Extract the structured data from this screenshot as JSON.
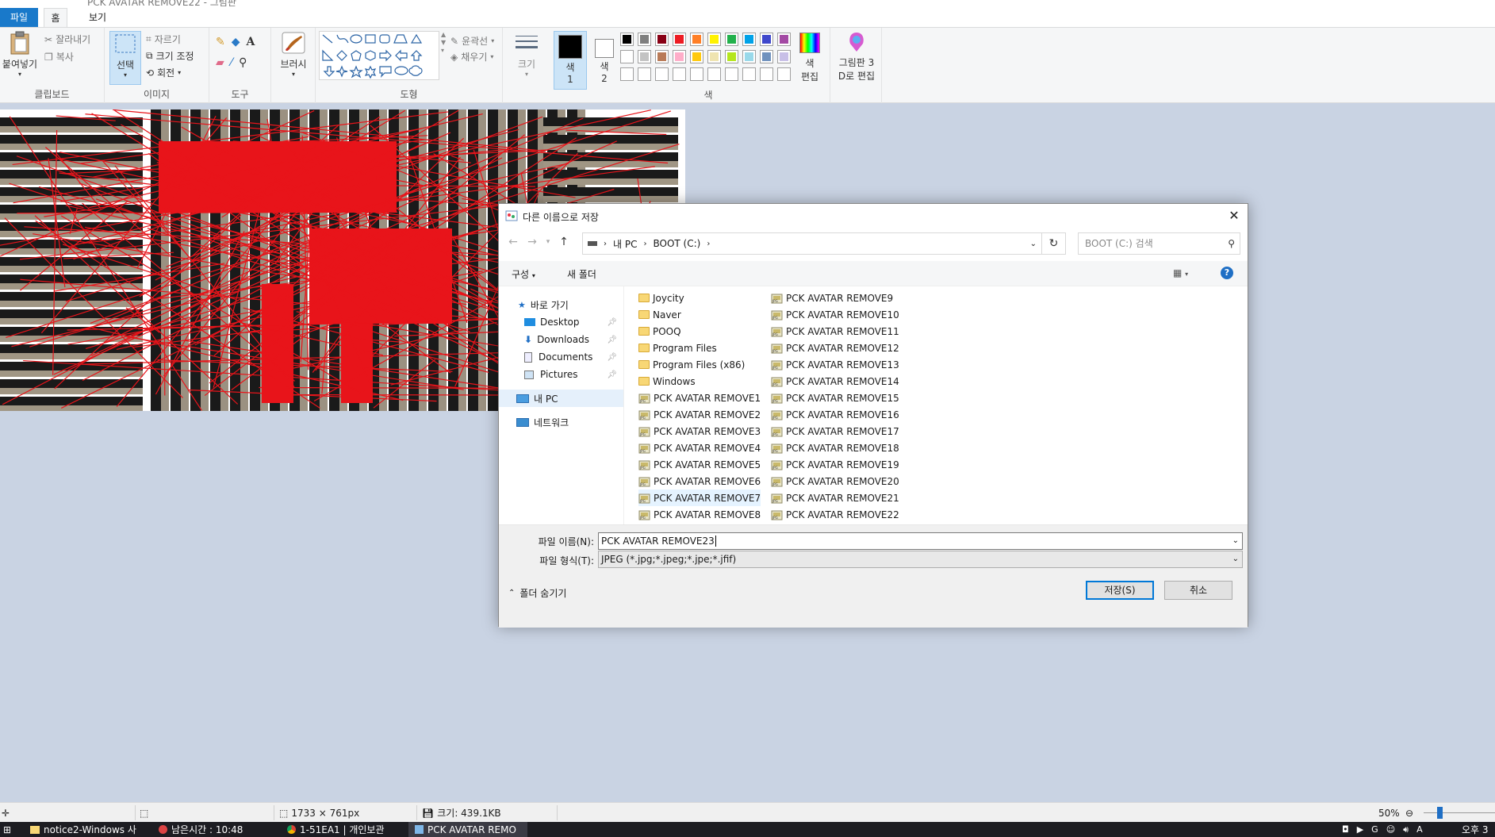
{
  "window": {
    "title": "PCK AVATAR REMOVE22 - 그림판"
  },
  "tabs": {
    "file": "파일",
    "home": "홈",
    "view": "보기"
  },
  "ribbon": {
    "clipboard": {
      "paste": "붙여넣기",
      "cut": "잘라내기",
      "copy": "복사",
      "label": "클립보드"
    },
    "image": {
      "select": "선택",
      "crop": "자르기",
      "resize": "크기 조정",
      "rotate": "회전",
      "label": "이미지"
    },
    "tools": {
      "label": "도구"
    },
    "brush": {
      "label": "브러시"
    },
    "shapes": {
      "outline": "윤곽선",
      "fill": "채우기",
      "label": "도형"
    },
    "size": {
      "label": "크기"
    },
    "color1": {
      "line1": "색",
      "line2": "1"
    },
    "color2": {
      "line1": "색",
      "line2": "2"
    },
    "edit_colors": {
      "line1": "색",
      "line2": "편집"
    },
    "paint3d": {
      "line1": "그림판 3",
      "line2": "D로 편집"
    },
    "colors_label": "색",
    "palette_row1": [
      "#000000",
      "#7f7f7f",
      "#880015",
      "#ed1c24",
      "#ff7f27",
      "#fff200",
      "#22b14c",
      "#00a2e8",
      "#3f48cc",
      "#a349a4"
    ],
    "palette_row2": [
      "#ffffff",
      "#c3c3c3",
      "#b97a57",
      "#ffaec9",
      "#ffc90e",
      "#efe4b0",
      "#b5e61d",
      "#99d9ea",
      "#7092be",
      "#c8bfe7"
    ]
  },
  "dialog": {
    "title": "다른 이름으로 저장",
    "breadcrumb": [
      "내 PC",
      "BOOT (C:)"
    ],
    "search_placeholder": "BOOT (C:) 검색",
    "organize": "구성",
    "new_folder": "새 폴더",
    "nav": {
      "quick_access": "바로 가기",
      "desktop": "Desktop",
      "downloads": "Downloads",
      "documents": "Documents",
      "pictures": "Pictures",
      "this_pc": "내 PC",
      "network": "네트워크"
    },
    "folders": [
      "Joycity",
      "Naver",
      "POOQ",
      "Program Files",
      "Program Files (x86)",
      "Windows"
    ],
    "files_col1": [
      "PCK AVATAR REMOVE1",
      "PCK AVATAR REMOVE2",
      "PCK AVATAR REMOVE3",
      "PCK AVATAR REMOVE4",
      "PCK AVATAR REMOVE5",
      "PCK AVATAR REMOVE6",
      "PCK AVATAR REMOVE7",
      "PCK AVATAR REMOVE8"
    ],
    "files_col2": [
      "PCK AVATAR REMOVE9",
      "PCK AVATAR REMOVE10",
      "PCK AVATAR REMOVE11",
      "PCK AVATAR REMOVE12",
      "PCK AVATAR REMOVE13",
      "PCK AVATAR REMOVE14",
      "PCK AVATAR REMOVE15",
      "PCK AVATAR REMOVE16",
      "PCK AVATAR REMOVE17",
      "PCK AVATAR REMOVE18",
      "PCK AVATAR REMOVE19",
      "PCK AVATAR REMOVE20",
      "PCK AVATAR REMOVE21",
      "PCK AVATAR REMOVE22"
    ],
    "filename_label": "파일 이름(N):",
    "filename_value": "PCK AVATAR REMOVE23",
    "filetype_label": "파일 형식(T):",
    "filetype_value": "JPEG (*.jpg;*.jpeg;*.jpe;*.jfif)",
    "hide_folders": "폴더 숨기기",
    "save": "저장(S)",
    "cancel": "취소"
  },
  "status": {
    "dimensions": "1733 × 761px",
    "size": "크기: 439.1KB",
    "zoom": "50%"
  },
  "taskbar": {
    "items": [
      "notice2-Windows 사",
      "남은시간 : 10:48",
      "1-51EA1 | 개인보관",
      "PCK AVATAR REMO"
    ],
    "clock": "오후 3"
  }
}
